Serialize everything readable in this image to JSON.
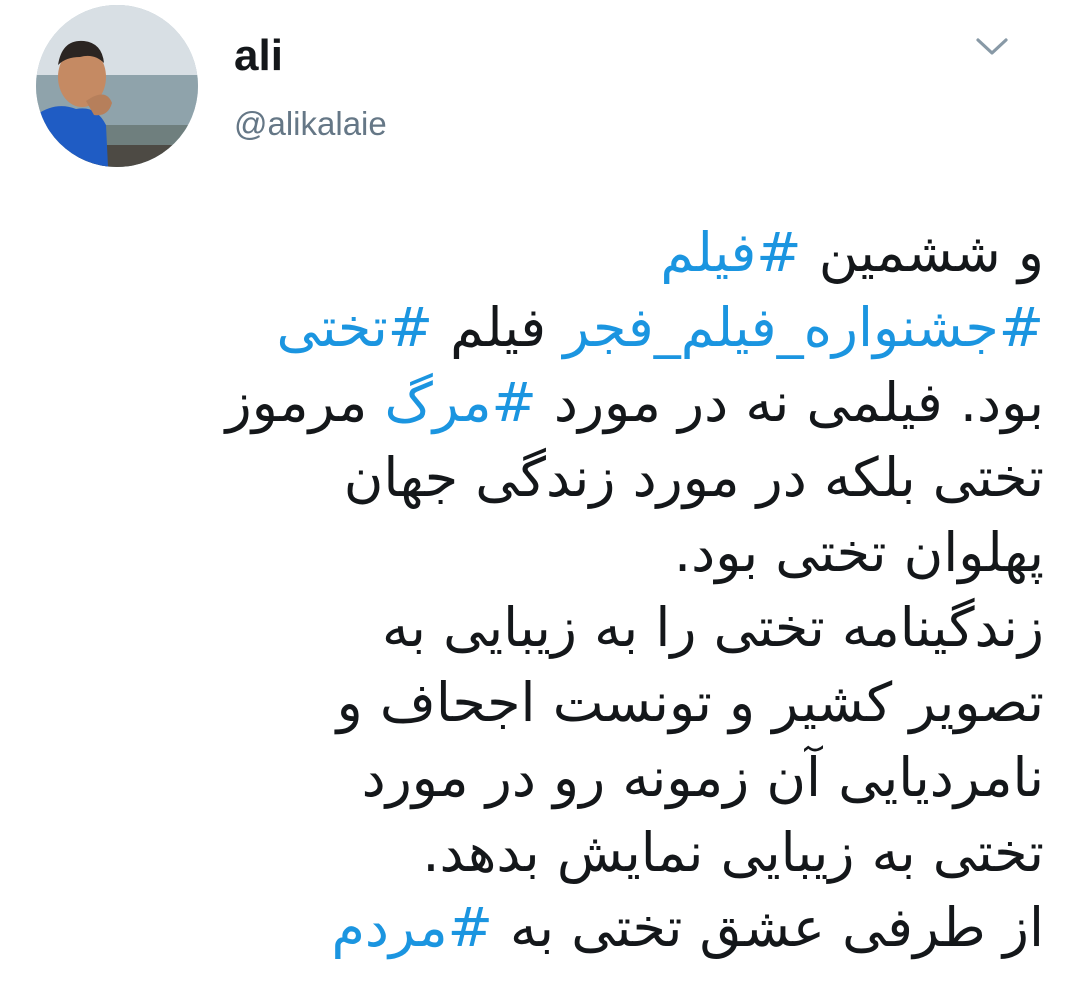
{
  "user": {
    "display_name": "ali",
    "handle": "@alikalaie"
  },
  "icons": {
    "menu": "chevron-down-icon"
  },
  "colors": {
    "hashtag": "#1b95e0",
    "text": "#14171a",
    "handle": "#657786"
  },
  "tweet": {
    "lines": [
      {
        "segments": [
          {
            "t": "و ششمین ",
            "tag": false
          },
          {
            "t": "#فیلم",
            "tag": true
          }
        ]
      },
      {
        "segments": [
          {
            "t": "#جشنواره_فیلم_فجر",
            "tag": true
          },
          {
            "t": "  فیلم ",
            "tag": false
          },
          {
            "t": "#تختی",
            "tag": true
          }
        ]
      },
      {
        "segments": [
          {
            "t": "بود. فیلمی نه در مورد ",
            "tag": false
          },
          {
            "t": "#مرگ",
            "tag": true
          },
          {
            "t": " مرموز",
            "tag": false
          }
        ]
      },
      {
        "segments": [
          {
            "t": "تختی بلکه در مورد زندگی جهان",
            "tag": false
          }
        ]
      },
      {
        "segments": [
          {
            "t": "پهلوان تختی بود.",
            "tag": false
          }
        ]
      },
      {
        "segments": [
          {
            "t": "زندگینامه تختی را به زیبایی به",
            "tag": false
          }
        ]
      },
      {
        "segments": [
          {
            "t": "تصویر کشیر و تونست اجحاف و",
            "tag": false
          }
        ]
      },
      {
        "segments": [
          {
            "t": "نامردیایی آن زمونه رو در مورد",
            "tag": false
          }
        ]
      },
      {
        "segments": [
          {
            "t": "تختی به زیبایی نمایش بدهد.",
            "tag": false
          }
        ]
      },
      {
        "segments": [
          {
            "t": "از طرفی عشق تختی به ",
            "tag": false
          },
          {
            "t": "#مردم",
            "tag": true
          }
        ]
      }
    ]
  }
}
